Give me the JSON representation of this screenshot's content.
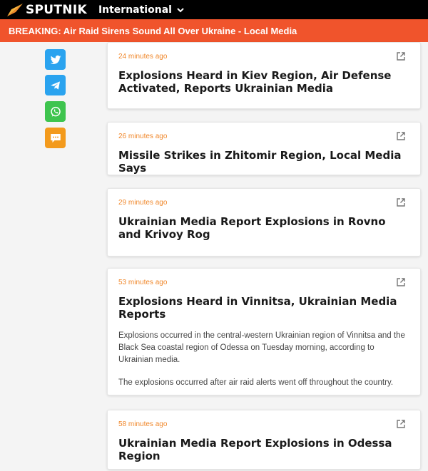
{
  "header": {
    "logo_text": "SPUTNIK",
    "edition_label": "International",
    "edition_icon": "chevron-down-icon"
  },
  "breaking": {
    "text": "BREAKING: Air Raid Sirens Sound All Over Ukraine - Local Media"
  },
  "share": [
    {
      "name": "twitter",
      "icon": "twitter-icon",
      "color": "#2aa3ef"
    },
    {
      "name": "telegram",
      "icon": "telegram-icon",
      "color": "#2aa3ef"
    },
    {
      "name": "whatsapp",
      "icon": "whatsapp-icon",
      "color": "#3ec44e"
    },
    {
      "name": "comments",
      "icon": "comment-icon",
      "color": "#f39a1c"
    }
  ],
  "items": [
    {
      "time": "24 minutes ago",
      "title": "Explosions Heard in Kiev Region, Air Defense Activated, Reports Ukrainian Media"
    },
    {
      "time": "26 minutes ago",
      "title": "Missile Strikes in Zhitomir Region, Local Media Says"
    },
    {
      "time": "29 minutes ago",
      "title": "Ukrainian Media Report Explosions in Rovno and Krivoy Rog"
    },
    {
      "time": "53 minutes ago",
      "title": "Explosions Heard in Vinnitsa, Ukrainian Media Reports",
      "body": [
        "Explosions occurred in the central-western Ukrainian region of Vinnitsa and the Black Sea coastal region of Odessa on Tuesday morning, according to Ukrainian media.",
        "The explosions occurred after air raid alerts went off throughout the country."
      ]
    },
    {
      "time": "58 minutes ago",
      "title": "Ukrainian Media Report Explosions in Odessa Region"
    }
  ],
  "colors": {
    "accent": "#f0542c",
    "timestamp": "#f0882c",
    "header_bg": "#000000"
  }
}
